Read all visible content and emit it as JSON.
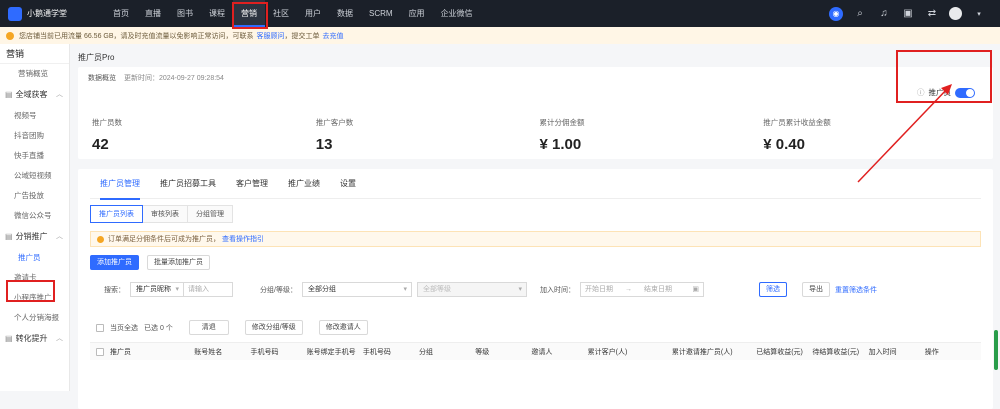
{
  "app": {
    "brand": "小鹅通学堂"
  },
  "topnav": {
    "items": [
      "首页",
      "直播",
      "图书",
      "课程",
      "营销",
      "社区",
      "用户",
      "数据",
      "SCRM",
      "应用",
      "企业微信"
    ],
    "active_index": 4
  },
  "notice": {
    "text": "您店铺当前已用流量 66.56 GB，请及时充值流量以免影响正常访问，可联系",
    "link1": "客服顾问",
    "text2": "，提交工单",
    "link2": "去充值"
  },
  "sidebar": {
    "title": "营销",
    "items": [
      {
        "type": "item",
        "label": "营销概览"
      },
      {
        "type": "group",
        "label": "全域获客"
      },
      {
        "type": "item",
        "label": "视频号"
      },
      {
        "type": "item",
        "label": "抖音团购"
      },
      {
        "type": "item",
        "label": "快手直播"
      },
      {
        "type": "item",
        "label": "公域短视频"
      },
      {
        "type": "item",
        "label": "广告投放"
      },
      {
        "type": "item",
        "label": "微信公众号"
      },
      {
        "type": "group",
        "label": "分销推广"
      },
      {
        "type": "item",
        "label": "推广员",
        "active": true
      },
      {
        "type": "item",
        "label": "邀请卡"
      },
      {
        "type": "item",
        "label": "小程序推广"
      },
      {
        "type": "item",
        "label": "个人分销海报"
      },
      {
        "type": "group",
        "label": "转化提升"
      }
    ]
  },
  "page": {
    "title": "推广员Pro",
    "stats_header": "数据概览",
    "stats_update": "更新时间：2024-09-27 09:28:54",
    "toggle_label": "推广员",
    "stats": [
      {
        "label": "推广员数",
        "value": "42"
      },
      {
        "label": "推广客户数",
        "value": "13"
      },
      {
        "label": "累计分佣金额",
        "value": "¥ 1.00"
      },
      {
        "label": "推广员累计收益金额",
        "value": "¥ 0.40"
      }
    ]
  },
  "tabs": [
    "推广员管理",
    "推广员招募工具",
    "客户管理",
    "推广业绩",
    "设置"
  ],
  "subtabs": [
    "推广员列表",
    "审核列表",
    "分组管理"
  ],
  "tip": {
    "text": "订单满足分佣条件后可成为推广员，",
    "link": "查看操作指引"
  },
  "buttons": {
    "add": "添加推广员",
    "batch_add": "批量添加推广员"
  },
  "filter": {
    "search_label": "搜索：",
    "search_type": "推广员昵称",
    "search_placeholder": "请输入",
    "group_label": "分组/等级：",
    "group_value": "全部分组",
    "level_value": "全部等级",
    "time_label": "加入时间：",
    "start_placeholder": "开始日期",
    "end_placeholder": "结束日期",
    "filter_btn": "筛选",
    "export_btn": "导出",
    "reset_link": "重置筛选条件"
  },
  "batch": {
    "select_all": "当页全选",
    "selected": "已选 0 个",
    "btn_clear": "清退",
    "btn_group": "修改分组/等级",
    "btn_inviter": "修改邀请人"
  },
  "table": {
    "headers": [
      "推广员",
      "账号姓名",
      "手机号码",
      "账号绑定手机号",
      "手机号码",
      "分组",
      "等级",
      "邀请人",
      "累计客户(人)",
      "累计邀请推广员(人)",
      "已结算收益(元)",
      "待结算收益(元)",
      "加入时间",
      "操作"
    ]
  }
}
